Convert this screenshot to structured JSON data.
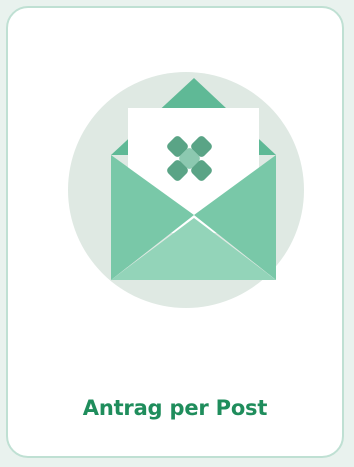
{
  "card": {
    "label": "Antrag per Post",
    "icon": "envelope-with-letter-icon",
    "colors": {
      "label": "#1f8d5c",
      "circle": "#dfe9e3",
      "envelope_dark": "#5fb996",
      "envelope_mid": "#79c8a8",
      "envelope_light": "#93d4b9",
      "letter": "#ffffff",
      "logo_dark": "#5aa486",
      "logo_light": "#8cc9b0",
      "border": "#bfe0d3"
    }
  }
}
